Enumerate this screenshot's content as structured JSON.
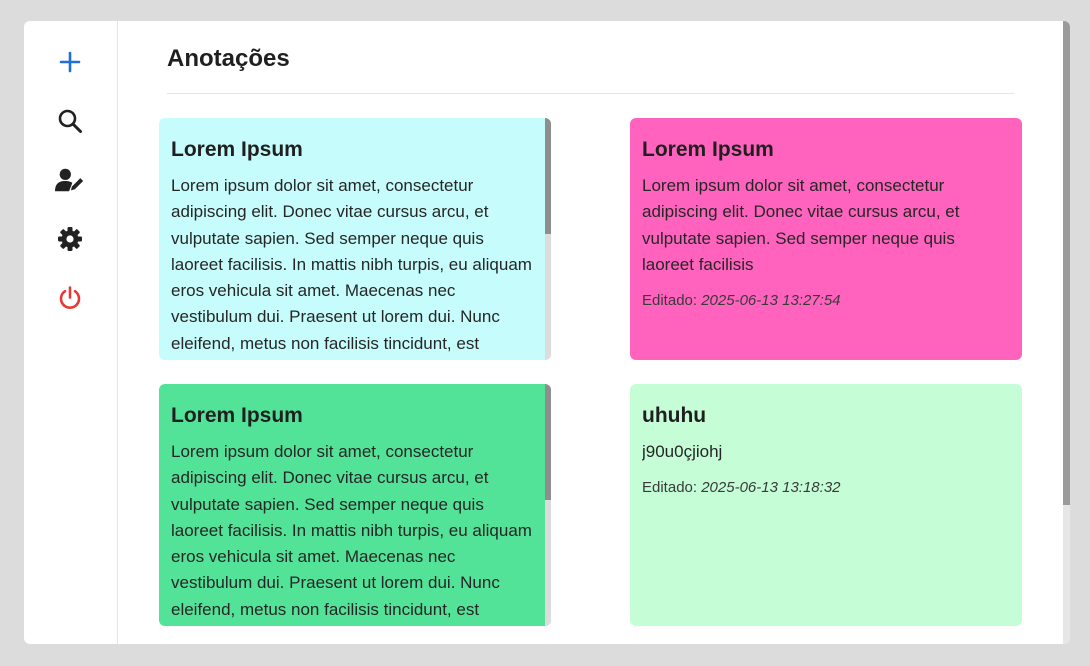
{
  "sidebar": {
    "items": [
      {
        "icon": "plus-icon",
        "color": "#1e6fd9"
      },
      {
        "icon": "search-icon",
        "color": "#222222"
      },
      {
        "icon": "user-edit-icon",
        "color": "#222222"
      },
      {
        "icon": "gear-icon",
        "color": "#222222"
      },
      {
        "icon": "power-icon",
        "color": "#e53935"
      }
    ]
  },
  "main": {
    "title": "Anotações"
  },
  "notes": [
    {
      "title": "Lorem Ipsum",
      "body": "Lorem ipsum dolor sit amet, consectetur adipiscing elit. Donec vitae cursus arcu, et vulputate sapien. Sed semper neque quis laoreet facilisis. In mattis nibh turpis, eu aliquam eros vehicula sit amet. Maecenas nec vestibulum dui. Praesent ut lorem dui. Nunc eleifend, metus non facilisis tincidunt, est",
      "color": "#c6fcfc"
    },
    {
      "title": "Lorem Ipsum",
      "body": "Lorem ipsum dolor sit amet, consectetur adipiscing elit. Donec vitae cursus arcu, et vulputate sapien. Sed semper neque quis laoreet facilisis",
      "edited_label": "Editado:",
      "edited_stamp": "2025-06-13 13:27:54",
      "color": "#ff63be"
    },
    {
      "title": "Lorem Ipsum",
      "body": "Lorem ipsum dolor sit amet, consectetur adipiscing elit. Donec vitae cursus arcu, et vulputate sapien. Sed semper neque quis laoreet facilisis. In mattis nibh turpis, eu aliquam eros vehicula sit amet. Maecenas nec vestibulum dui. Praesent ut lorem dui. Nunc eleifend, metus non facilisis tincidunt, est",
      "color": "#52e298"
    },
    {
      "title": "uhuhu",
      "body": "j90u0çjiohj",
      "edited_label": "Editado:",
      "edited_stamp": "2025-06-13 13:18:32",
      "color": "#c5fdd7"
    }
  ]
}
